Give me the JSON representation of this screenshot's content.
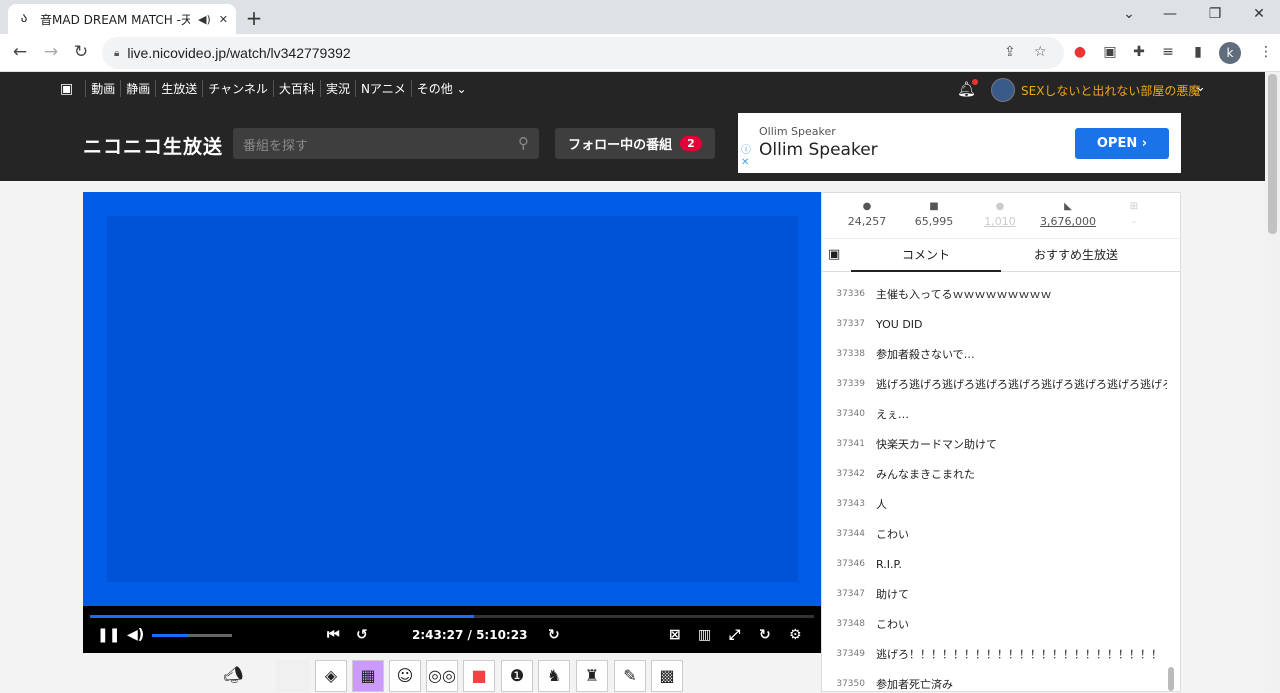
{
  "browser": {
    "tab_title": "音MAD DREAM MATCH -天",
    "url": "live.nicovideo.jp/watch/lv342779392",
    "profile_initial": "k"
  },
  "site": {
    "nav_items": [
      "動画",
      "静画",
      "生放送",
      "チャンネル",
      "大百科",
      "実況",
      "Nアニメ",
      "その他 ⌄"
    ],
    "user_name": "SEXしないと出れない部屋の悪魔",
    "logo": "ニコニコ生放送",
    "search_placeholder": "番組を探す",
    "follow_label": "フォロー中の番組",
    "follow_count": "2"
  },
  "ad": {
    "small": "Ollim Speaker",
    "title": "Ollim Speaker",
    "button": "OPEN ›"
  },
  "player": {
    "time": "2:43:27 / 5:10:23",
    "progress": 0.53,
    "volume": 0.45
  },
  "stats": {
    "viewers": "24,257",
    "comments": "65,995",
    "ad_points": "1,010",
    "gift_points": "3,676,000",
    "gifts": "-"
  },
  "panel": {
    "tab_comment": "コメント",
    "tab_recommend": "おすすめ生放送"
  },
  "comments": [
    {
      "no": "37336",
      "text": "主催も入ってるｗｗｗｗｗｗｗｗｗ"
    },
    {
      "no": "37337",
      "text": "YOU DID"
    },
    {
      "no": "37338",
      "text": "参加者殺さないで…"
    },
    {
      "no": "37339",
      "text": "逃げろ逃げろ逃げろ逃げろ逃げろ逃げろ逃げろ逃げろ逃げろ"
    },
    {
      "no": "37340",
      "text": "えぇ…"
    },
    {
      "no": "37341",
      "text": "快楽天カードマン助けて"
    },
    {
      "no": "37342",
      "text": "みんなまきこまれた"
    },
    {
      "no": "37343",
      "text": "人"
    },
    {
      "no": "37344",
      "text": "こわい"
    },
    {
      "no": "37346",
      "text": "R.I.P."
    },
    {
      "no": "37347",
      "text": "助けて"
    },
    {
      "no": "37348",
      "text": "こわい"
    },
    {
      "no": "37349",
      "text": "逃げろ！！！！！！！！！！！！！！！！！！！！！！！"
    },
    {
      "no": "37350",
      "text": "参加者死亡済み"
    }
  ]
}
